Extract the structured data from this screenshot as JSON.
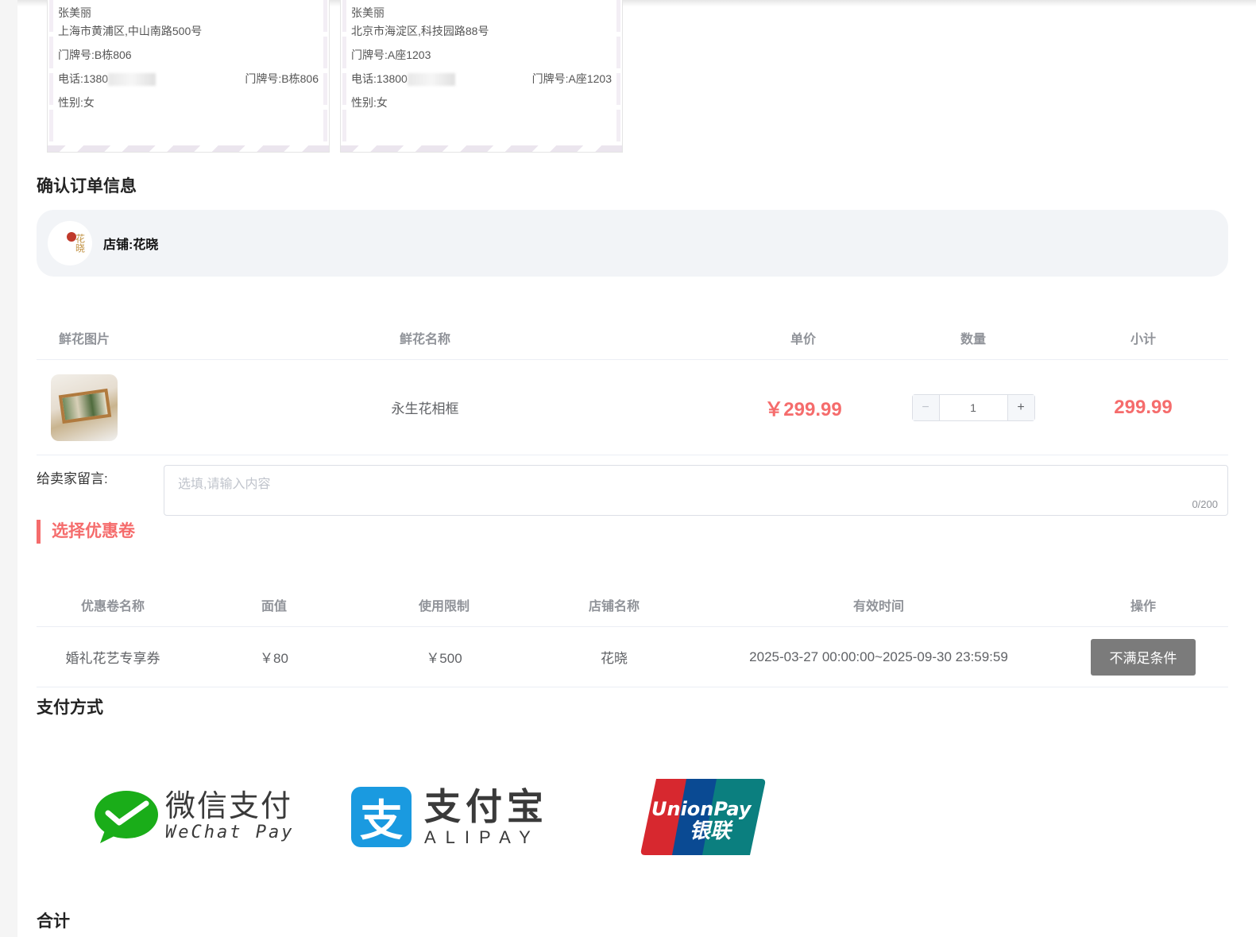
{
  "addresses": [
    {
      "name": "张美丽",
      "address": "上海市黄浦区,中山南路500号",
      "door": "门牌号:B栋806",
      "phone": "电话:1380",
      "door_right": "门牌号:B栋806",
      "gender": "性别:女"
    },
    {
      "name": "张美丽",
      "address": "北京市海淀区,科技园路88号",
      "door": "门牌号:A座1203",
      "phone": "电话:13800",
      "door_right": "门牌号:A座1203",
      "gender": "性别:女"
    }
  ],
  "order_title": "确认订单信息",
  "shop": {
    "logo_text": "花晓",
    "name": "店铺:花晓"
  },
  "product_table": {
    "headers": [
      "鲜花图片",
      "鲜花名称",
      "单价",
      "数量",
      "小计"
    ],
    "row": {
      "name": "永生花相框",
      "price": "￥299.99",
      "quantity": "1",
      "subtotal": "299.99"
    }
  },
  "message": {
    "label": "给卖家留言:",
    "placeholder": "选填,请输入内容",
    "count": "0/200"
  },
  "coupon": {
    "title": "选择优惠卷",
    "headers": [
      "优惠卷名称",
      "面值",
      "使用限制",
      "店铺名称",
      "有效时间",
      "操作"
    ],
    "rows": [
      {
        "name": "婚礼花艺专享券",
        "value": "￥80",
        "limit": "￥500",
        "shop": "花晓",
        "period": "2025-03-27 00:00:00~2025-09-30 23:59:59",
        "action": "不满足条件"
      }
    ]
  },
  "payment": {
    "title": "支付方式",
    "wechat": {
      "cn": "微信支付",
      "en": "WeChat Pay"
    },
    "alipay": {
      "cn": "支付宝",
      "en": "ALIPAY",
      "icon": "支"
    },
    "unionpay": {
      "en": "UnionPay",
      "cn": "银联"
    }
  },
  "total_title": "合计",
  "colors": {
    "accent": "#f56c6c",
    "wechat": "#1aad19",
    "alipay": "#1a9ae0",
    "union_red": "#d7282f",
    "union_blue": "#0a4a93",
    "union_teal": "#0b7f7f"
  }
}
